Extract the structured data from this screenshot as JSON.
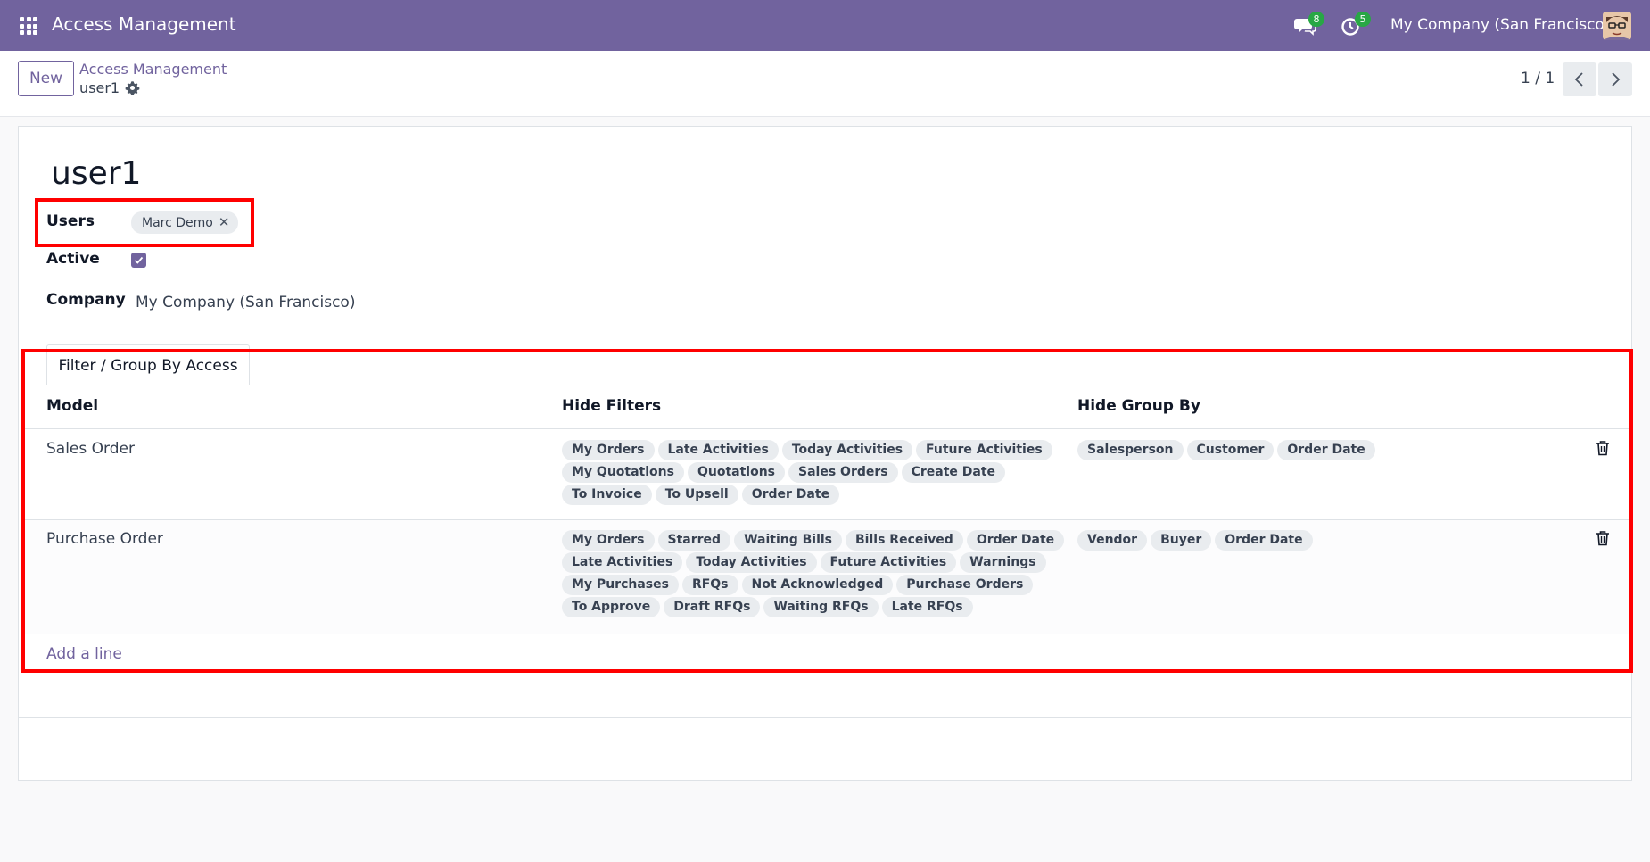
{
  "navbar": {
    "app_title": "Access Management",
    "messages_badge": "8",
    "activities_badge": "5",
    "company": "My Company (San Francisco)"
  },
  "control_panel": {
    "new_label": "New",
    "breadcrumb_parent": "Access Management",
    "breadcrumb_current": "user1",
    "pager": "1 / 1"
  },
  "form": {
    "title": "user1",
    "users_label": "Users",
    "users_tag": "Marc Demo",
    "active_label": "Active",
    "active_checked": true,
    "company_label": "Company",
    "company_value": "My Company (San Francisco)"
  },
  "tab": {
    "label": "Filter / Group By Access"
  },
  "table": {
    "headers": {
      "model": "Model",
      "hide_filters": "Hide Filters",
      "hide_group_by": "Hide Group By"
    },
    "rows": [
      {
        "model": "Sales Order",
        "filters": [
          "My Orders",
          "Late Activities",
          "Today Activities",
          "Future Activities",
          "My Quotations",
          "Quotations",
          "Sales Orders",
          "Create Date",
          "To Invoice",
          "To Upsell",
          "Order Date"
        ],
        "group_by": [
          "Salesperson",
          "Customer",
          "Order Date"
        ]
      },
      {
        "model": "Purchase Order",
        "filters": [
          "My Orders",
          "Starred",
          "Waiting Bills",
          "Bills Received",
          "Order Date",
          "Late Activities",
          "Today Activities",
          "Future Activities",
          "Warnings",
          "My Purchases",
          "RFQs",
          "Not Acknowledged",
          "Purchase Orders",
          "To Approve",
          "Draft RFQs",
          "Waiting RFQs",
          "Late RFQs"
        ],
        "group_by": [
          "Vendor",
          "Buyer",
          "Order Date"
        ]
      }
    ],
    "add_line": "Add a line"
  },
  "colors": {
    "brand": "#71639e",
    "badge": "#28a745",
    "highlight": "#ff0000"
  }
}
